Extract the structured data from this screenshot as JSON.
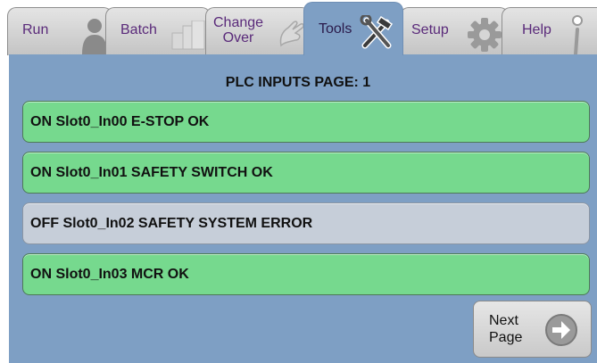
{
  "tabs": [
    {
      "key": "run",
      "label": "Run",
      "icon": "person-icon",
      "active": false
    },
    {
      "key": "batch",
      "label": "Batch",
      "icon": "boxes-icon",
      "active": false
    },
    {
      "key": "changeover",
      "label": "Change Over",
      "icon": "hand-icon",
      "active": false
    },
    {
      "key": "tools",
      "label": "Tools",
      "icon": "hammer-wrench-icon",
      "active": true
    },
    {
      "key": "setup",
      "label": "Setup",
      "icon": "gear-icon",
      "active": false
    },
    {
      "key": "help",
      "label": "Help",
      "icon": "info-icon",
      "active": false
    }
  ],
  "page": {
    "title": "PLC INPUTS PAGE: 1"
  },
  "inputs": [
    {
      "text": "ON Slot0_In00 E-STOP OK",
      "state": "on",
      "color": "#76d98e"
    },
    {
      "text": "ON Slot0_In01 SAFETY SWITCH OK",
      "state": "on",
      "color": "#76d98e"
    },
    {
      "text": "OFF Slot0_In02 SAFETY SYSTEM ERROR",
      "state": "off",
      "color": "#c6ced9"
    },
    {
      "text": "ON Slot0_In03 MCR OK",
      "state": "on",
      "color": "#76d98e"
    }
  ],
  "next_button": {
    "label": "Next\nPage",
    "icon": "arrow-right-circle-icon"
  },
  "colors": {
    "panel": "#7e9fc4",
    "on": "#76d98e",
    "off": "#c6ced9",
    "tab_text": "#5a2a7a"
  }
}
